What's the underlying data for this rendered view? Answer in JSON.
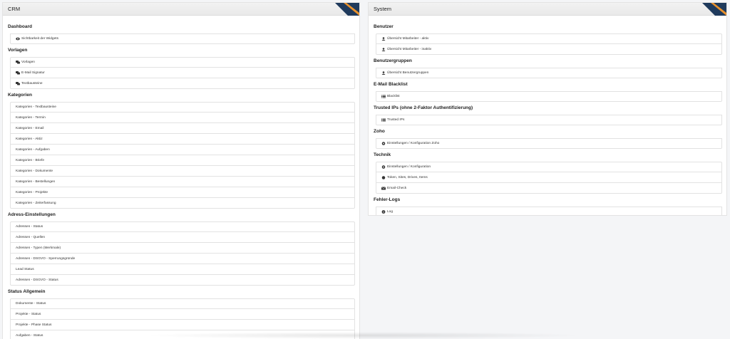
{
  "left_panel": {
    "title": "CRM",
    "sections": [
      {
        "title": "Dashboard",
        "items": [
          {
            "icon": "eye-icon",
            "label": "Sichtbarkeit der Widgets"
          }
        ]
      },
      {
        "title": "Vorlagen",
        "items": [
          {
            "icon": "comments-icon",
            "label": "Vorlagen"
          },
          {
            "icon": "comments-icon",
            "label": "E-Mail Signatur"
          },
          {
            "icon": "comments-icon",
            "label": "Textbausteine"
          }
        ]
      },
      {
        "title": "Kategorien",
        "items": [
          {
            "label": "Kategorien - Textbausteine"
          },
          {
            "label": "Kategorien - Termin"
          },
          {
            "label": "Kategorien - Email"
          },
          {
            "label": "Kategorien - Aktiz"
          },
          {
            "label": "Kategorien - Aufgaben"
          },
          {
            "label": "Kategorien - Briefe"
          },
          {
            "label": "Kategorien - Dokumente"
          },
          {
            "label": "Kategorien - Bestellungen"
          },
          {
            "label": "Kategorien - Projekte"
          },
          {
            "label": "Kategorien - Zeiterfassung"
          }
        ]
      },
      {
        "title": "Adress-Einstellungen",
        "items": [
          {
            "label": "Adressen - Status"
          },
          {
            "label": "Adressen - Quellen"
          },
          {
            "label": "Adressen - Typen (Merkmale)"
          },
          {
            "label": "Adressen - DSGVO - Sperrungsgründe"
          },
          {
            "label": "Lead Status"
          },
          {
            "label": "Adressen - DSGVO - Status"
          }
        ]
      },
      {
        "title": "Status Allgemein",
        "items": [
          {
            "label": "Dokumente - Status"
          },
          {
            "label": "Projekte - Status"
          },
          {
            "label": "Projekte - Phase Status"
          },
          {
            "label": "Aufgaben - Status"
          }
        ]
      }
    ]
  },
  "right_panel": {
    "title": "System",
    "sections": [
      {
        "title": "Benutzer",
        "items": [
          {
            "icon": "user-icon",
            "label": "Übersicht Mitarbeiter - aktiv"
          },
          {
            "icon": "user-icon",
            "label": "Übersicht Mitarbeiter - inaktiv"
          }
        ]
      },
      {
        "title": "Benutzergruppen",
        "items": [
          {
            "icon": "user-icon",
            "label": "Übersicht Benutzergruppen"
          }
        ]
      },
      {
        "title": "E-Mail Blacklist",
        "items": [
          {
            "icon": "list-icon",
            "label": "Blacklist"
          }
        ]
      },
      {
        "title": "Trusted IPs (ohne 2-Faktor Authentifizierung)",
        "items": [
          {
            "icon": "list-icon",
            "label": "Trusted IPs"
          }
        ]
      },
      {
        "title": "Zoho",
        "items": [
          {
            "icon": "gear-icon",
            "label": "Einstellungen / Konfiguration Zoho"
          }
        ]
      },
      {
        "title": "Technik",
        "items": [
          {
            "icon": "gear-icon",
            "label": "Einstellungen / Konfiguration"
          },
          {
            "icon": "circle-icon",
            "label": "Token, Sites, Drives, Items"
          },
          {
            "icon": "envelope-icon",
            "label": "Email-Check"
          }
        ]
      },
      {
        "title": "Fehler-Logs",
        "items": [
          {
            "icon": "info-icon",
            "label": "Log"
          }
        ]
      }
    ]
  },
  "colors": {
    "accent_navy": "#1f3a5c",
    "accent_orange": "#e8912d"
  }
}
